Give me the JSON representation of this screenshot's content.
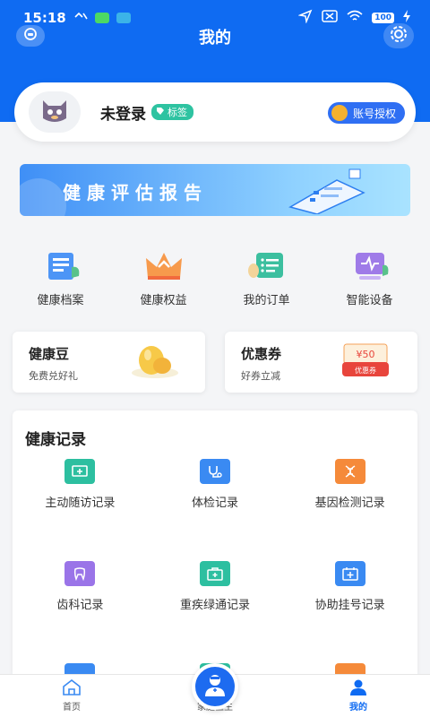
{
  "status_bar": {
    "time": "15:18",
    "battery": "100",
    "icons_left": [
      "mute-icon",
      "wechat-icon",
      "telegram-icon"
    ],
    "icons_right": [
      "location-icon",
      "sim-off-icon",
      "wifi-icon",
      "battery-icon",
      "charging-icon"
    ]
  },
  "header": {
    "title": "我的",
    "left_icon": "service-icon",
    "right_icon": "settings-gear-icon"
  },
  "profile": {
    "name": "未登录",
    "tag": "标签",
    "auth_button": "账号授权",
    "avatar_icon": "cat-avatar-icon"
  },
  "banner": {
    "text": "健康评估报告"
  },
  "quick_grid": [
    {
      "label": "健康档案",
      "icon": "health-file-icon"
    },
    {
      "label": "健康权益",
      "icon": "crown-icon"
    },
    {
      "label": "我的订单",
      "icon": "order-list-icon"
    },
    {
      "label": "智能设备",
      "icon": "smart-device-icon"
    }
  ],
  "promo_cards": [
    {
      "title": "健康豆",
      "subtitle": "免费兑好礼",
      "icon": "bean-icon"
    },
    {
      "title": "优惠券",
      "subtitle": "好券立减",
      "icon": "coupon-icon",
      "coupon_value": "¥50",
      "coupon_label": "优惠券"
    }
  ],
  "health_records": {
    "title": "健康记录",
    "items": [
      {
        "label": "主动随访记录",
        "icon": "followup-icon",
        "color": "#2dbfa0"
      },
      {
        "label": "体检记录",
        "icon": "stethoscope-icon",
        "color": "#3a8af2"
      },
      {
        "label": "基因检测记录",
        "icon": "dna-icon",
        "color": "#f58a3a"
      },
      {
        "label": "齿科记录",
        "icon": "tooth-icon",
        "color": "#9a74e8"
      },
      {
        "label": "重疾绿通记录",
        "icon": "medkit-icon",
        "color": "#2dbfa0"
      },
      {
        "label": "协助挂号记录",
        "icon": "calendar-plus-icon",
        "color": "#3a8af2"
      },
      {
        "label": "",
        "icon": "record-icon",
        "color": "#3a8af2"
      },
      {
        "label": "",
        "icon": "record-icon",
        "color": "#2dbfa0"
      },
      {
        "label": "",
        "icon": "record-icon",
        "color": "#f58a3a"
      }
    ]
  },
  "tab_bar": {
    "tabs": [
      {
        "label": "首页",
        "icon": "home-icon"
      },
      {
        "label": "家庭医生",
        "icon": "doctor-icon"
      },
      {
        "label": "我的",
        "icon": "user-icon"
      }
    ],
    "active": "我的"
  },
  "colors": {
    "primary": "#0f6bf2",
    "accent_green": "#2ec3a1"
  }
}
